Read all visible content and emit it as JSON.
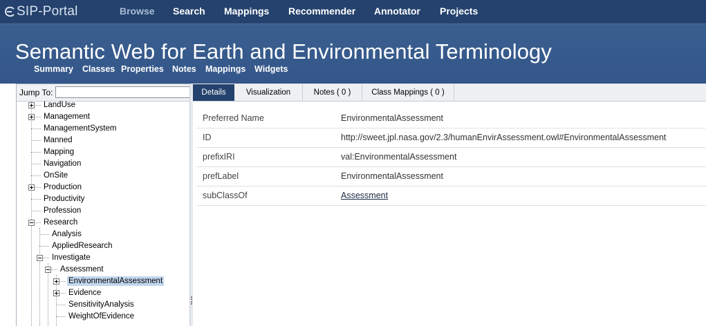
{
  "app": {
    "logo_text": "SIP-Portal",
    "colors": {
      "nav_bg": "#24426d",
      "header_bg": "#3a5f8f",
      "selected": "#c3d7ee"
    }
  },
  "topnav": [
    {
      "label": "Browse",
      "active": true
    },
    {
      "label": "Search"
    },
    {
      "label": "Mappings"
    },
    {
      "label": "Recommender"
    },
    {
      "label": "Annotator"
    },
    {
      "label": "Projects"
    }
  ],
  "header": {
    "title": "Semantic Web for Earth and Environmental Terminology",
    "subnav": [
      "Summary",
      "Classes",
      "Properties",
      "Notes",
      "Mappings",
      "Widgets"
    ]
  },
  "tree": {
    "jump_label": "Jump To:",
    "jump_value": "",
    "nodes": [
      {
        "label": "LandUse",
        "toggle": "plus"
      },
      {
        "label": "Management",
        "toggle": "plus"
      },
      {
        "label": "ManagementSystem"
      },
      {
        "label": "Manned"
      },
      {
        "label": "Mapping"
      },
      {
        "label": "Navigation"
      },
      {
        "label": "OnSite"
      },
      {
        "label": "Production",
        "toggle": "plus"
      },
      {
        "label": "Productivity"
      },
      {
        "label": "Profession"
      },
      {
        "label": "Research",
        "toggle": "minus"
      },
      {
        "label": "Analysis"
      },
      {
        "label": "AppliedResearch"
      },
      {
        "label": "Investigate",
        "toggle": "minus"
      },
      {
        "label": "Assessment",
        "toggle": "minus"
      },
      {
        "label": "EnvironmentalAssessment",
        "toggle": "plus",
        "selected": true
      },
      {
        "label": "Evidence",
        "toggle": "plus"
      },
      {
        "label": "SensitivityAnalysis"
      },
      {
        "label": "WeightOfEvidence"
      }
    ]
  },
  "tabs": [
    {
      "label": "Details",
      "active": true
    },
    {
      "label": "Visualization"
    },
    {
      "label": "Notes ( 0 )"
    },
    {
      "label": "Class Mappings ( 0 )"
    }
  ],
  "properties": [
    {
      "name": "Preferred Name",
      "value": "EnvironmentalAssessment"
    },
    {
      "name": "ID",
      "value": "http://sweet.jpl.nasa.gov/2.3/humanEnvirAssessment.owl#EnvironmentalAssessment"
    },
    {
      "name": "prefixIRI",
      "value": "val:EnvironmentalAssessment"
    },
    {
      "name": "prefLabel",
      "value": "EnvironmentalAssessment"
    },
    {
      "name": "subClassOf",
      "value": "Assessment",
      "link": true
    }
  ]
}
